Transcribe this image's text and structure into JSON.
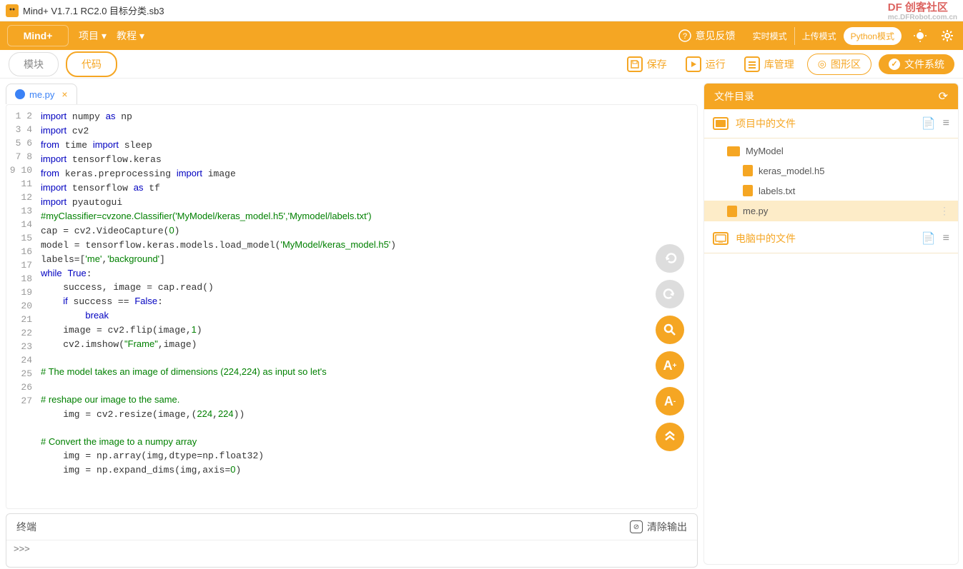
{
  "title": "Mind+ V1.7.1 RC2.0   目标分类.sb3",
  "watermark": {
    "brand": "DF 创客社区",
    "url": "mc.DFRobot.com.cn"
  },
  "menubar": {
    "logo": "Mind+",
    "project": "项目",
    "tutorial": "教程",
    "feedback": "意见反馈",
    "mode_realtime": "实时模式",
    "mode_upload": "上传模式",
    "mode_python": "Python模式"
  },
  "toolbar": {
    "tab_block": "模块",
    "tab_code": "代码",
    "save": "保存",
    "run": "运行",
    "lib": "库管理",
    "graph": "图形区",
    "files": "文件系统"
  },
  "filetab": {
    "name": "me.py"
  },
  "code_lines": [
    {
      "n": 1,
      "h": "<span class='kw'>import</span> numpy <span class='kw'>as</span> np"
    },
    {
      "n": 2,
      "h": "<span class='kw'>import</span> cv2"
    },
    {
      "n": 3,
      "h": "<span class='kw'>from</span> time <span class='kw'>import</span> sleep"
    },
    {
      "n": 4,
      "h": "<span class='kw'>import</span> tensorflow.keras"
    },
    {
      "n": 5,
      "h": "<span class='kw'>from</span> keras.preprocessing <span class='kw'>import</span> image"
    },
    {
      "n": 6,
      "h": "<span class='kw'>import</span> tensorflow <span class='kw'>as</span> tf"
    },
    {
      "n": 7,
      "h": "<span class='kw'>import</span> pyautogui"
    },
    {
      "n": 8,
      "h": "<span class='com'>#myClassifier=cvzone.Classifier('MyModel/keras_model.h5','Mymodel/labels.txt')</span>"
    },
    {
      "n": 9,
      "h": "cap = cv2.VideoCapture(<span class='num'>0</span>)"
    },
    {
      "n": 10,
      "h": "model = tensorflow.keras.models.load_model(<span class='str'>'MyModel/keras_model.h5'</span>)"
    },
    {
      "n": 11,
      "h": "labels=[<span class='str'>'me'</span>,<span class='str'>'background'</span>]"
    },
    {
      "n": 12,
      "h": "<span class='kw'>while</span> <span class='kw'>True</span>:"
    },
    {
      "n": 13,
      "h": "    success, image = cap.read()"
    },
    {
      "n": 14,
      "h": "    <span class='kw'>if</span> success == <span class='kw'>False</span>:"
    },
    {
      "n": 15,
      "h": "        <span class='kw'>break</span>"
    },
    {
      "n": 16,
      "h": "    image = cv2.flip(image,<span class='num'>1</span>)"
    },
    {
      "n": 17,
      "h": "    cv2.imshow(<span class='str'>\"Frame\"</span>,image)"
    },
    {
      "n": 18,
      "h": ""
    },
    {
      "n": 19,
      "h": "<span class='com'># The model takes an image of dimensions (224,224) as input so let's</span>"
    },
    {
      "n": 20,
      "h": ""
    },
    {
      "n": 21,
      "h": "<span class='com'># reshape our image to the same.</span>"
    },
    {
      "n": 22,
      "h": "    img = cv2.resize(image,(<span class='num'>224</span>,<span class='num'>224</span>))"
    },
    {
      "n": 23,
      "h": ""
    },
    {
      "n": 24,
      "h": "<span class='com'># Convert the image to a numpy array</span>"
    },
    {
      "n": 25,
      "h": "    img = np.array(img,dtype=np.float32)"
    },
    {
      "n": 26,
      "h": "    img = np.expand_dims(img,axis=<span class='num'>0</span>)"
    },
    {
      "n": 27,
      "h": ""
    }
  ],
  "terminal": {
    "title": "终端",
    "clear": "清除输出",
    "prompt": ">>> "
  },
  "sidebar": {
    "header": "文件目录",
    "project_files": "项目中的文件",
    "computer_files": "电脑中的文件",
    "tree": {
      "folder": "MyModel",
      "f1": "keras_model.h5",
      "f2": "labels.txt",
      "f3": "me.py"
    }
  }
}
